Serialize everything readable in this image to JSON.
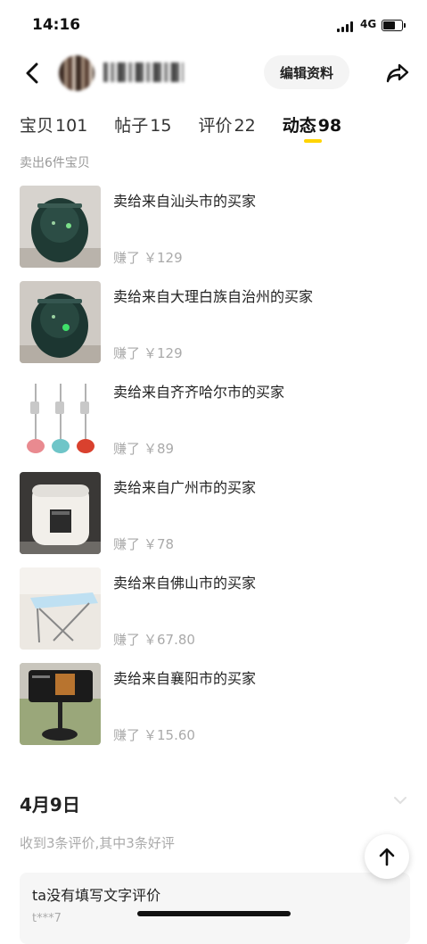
{
  "status_bar": {
    "time": "14:16",
    "network": "4G"
  },
  "header": {
    "edit_profile_label": "编辑资料"
  },
  "tabs": [
    {
      "label": "宝贝",
      "count": "101"
    },
    {
      "label": "帖子",
      "count": "15"
    },
    {
      "label": "评价",
      "count": "22"
    },
    {
      "label": "动态",
      "count": "98"
    }
  ],
  "sold_summary": "卖出6件宝贝",
  "items": [
    {
      "title": "卖给来自汕头市的买家",
      "earned_prefix": "赚了",
      "amount": "￥129",
      "icon": "air-fryer-photo"
    },
    {
      "title": "卖给来自大理白族自治州的买家",
      "earned_prefix": "赚了",
      "amount": "￥129",
      "icon": "air-fryer-photo"
    },
    {
      "title": "卖给来自齐齐哈尔市的买家",
      "earned_prefix": "赚了",
      "amount": "￥89",
      "icon": "garment-steamer-photo"
    },
    {
      "title": "卖给来自广州市的买家",
      "earned_prefix": "赚了",
      "amount": "￥78",
      "icon": "rice-cooker-photo"
    },
    {
      "title": "卖给来自佛山市的买家",
      "earned_prefix": "赚了",
      "amount": "￥67.80",
      "icon": "folding-table-photo"
    },
    {
      "title": "卖给来自襄阳市的买家",
      "earned_prefix": "赚了",
      "amount": "￥15.60",
      "icon": "phone-stand-photo"
    }
  ],
  "date_section": {
    "date": "4月9日",
    "review_summary": "收到3条评价,其中3条好评",
    "review_text": "ta没有填写文字评价",
    "reviewer": "t***7"
  },
  "colors": {
    "accent": "#ffd400",
    "muted_text": "#aaaaaa"
  }
}
